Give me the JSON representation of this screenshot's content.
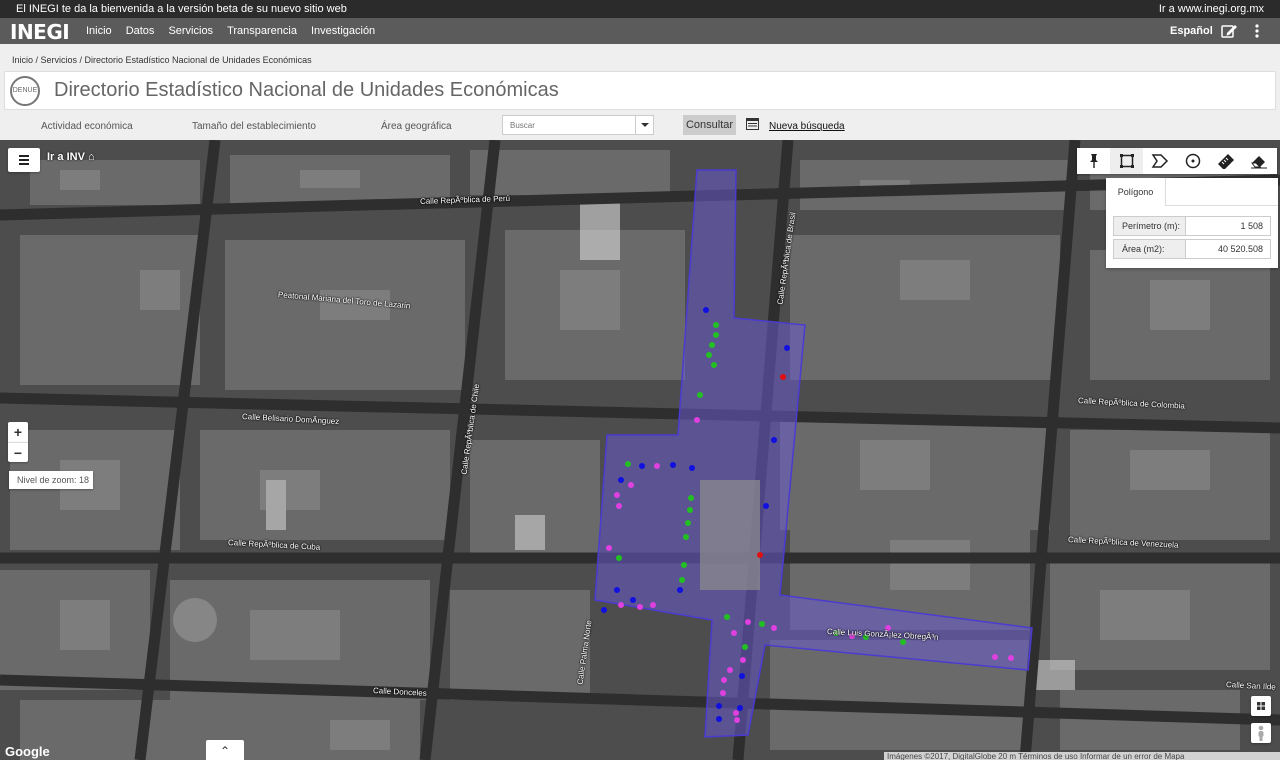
{
  "announcement": {
    "left": "El INEGI te da la bienvenida a la versión beta de su nuevo sitio web",
    "right": "Ir a www.inegi.org.mx"
  },
  "nav": {
    "logo": "INEGI",
    "items": [
      "Inicio",
      "Datos",
      "Servicios",
      "Transparencia",
      "Investigación"
    ],
    "language": "Español",
    "icons": [
      "edit-icon",
      "more-vert-icon"
    ]
  },
  "breadcrumb": "Inicio / Servicios / Directorio Estadístico Nacional de Unidades Económicas",
  "header": {
    "logo_text": "DENUE",
    "title": "Directorio Estadístico Nacional de Unidades Económicas"
  },
  "filters": {
    "actividad": "Actividad económica",
    "tamano": "Tamaño del establecimiento",
    "area": "Área geográfica",
    "search_placeholder": "Buscar",
    "consultar": "Consultar",
    "nueva": "Nueva búsqueda"
  },
  "map": {
    "ir_inv": "Ir a INV",
    "zoom_in": "+",
    "zoom_out": "−",
    "zoom_level": "Nivel de zoom: 18",
    "tools": [
      "pin-icon",
      "rectangle-icon",
      "polygon-icon",
      "circle-icon",
      "ruler-icon",
      "eraser-icon"
    ],
    "panel": {
      "tab": "Polígono",
      "perimetro_label": "Perímetro (m):",
      "perimetro_value": "1 508",
      "area_label": "Área (m2):",
      "area_value": "40 520.508"
    },
    "streets": [
      "Calle RepÃºblica de Perú",
      "Peatonal Mariana del Toro de Lazarin",
      "Calle Belisario DomÃ­nguez",
      "Calle RepÃºblica de Chile",
      "Calle RepÃºblica de Brasil",
      "Calle RepÃºblica de Colombia",
      "Calle RepÃºblica de Cuba",
      "Calle RepÃºblica de Venezuela",
      "Calle Luis GonzÃ¡lez ObregÃ³n",
      "Calle Donceles",
      "Calle Palma Norte",
      "Calle San Ilde"
    ],
    "google": "Google",
    "attribution": "Imágenes ©2017, DigitalGlobe   20 m   Términos de uso   Informar de un error de Mapa",
    "expand": "⌃",
    "colors": {
      "polygon_fill": "#6a5acd",
      "marker_green": "#22c022",
      "marker_magenta": "#e040e0",
      "marker_blue": "#1010e0",
      "marker_red": "#e01010"
    }
  }
}
